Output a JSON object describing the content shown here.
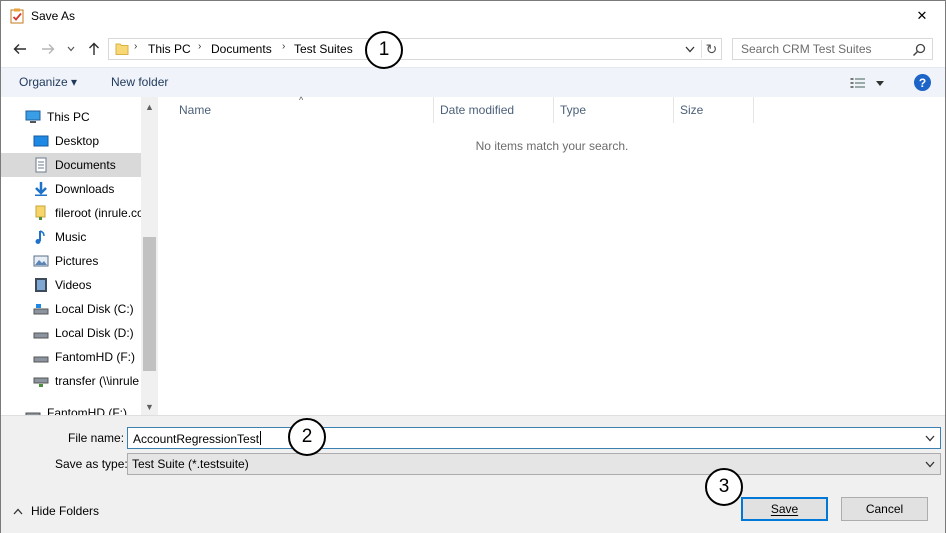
{
  "window": {
    "title": "Save As",
    "close_glyph": "✕"
  },
  "address": {
    "crumbs": [
      "This PC",
      "Documents",
      "Test Suites"
    ],
    "separator": "›",
    "refresh_glyph": "↻"
  },
  "search": {
    "placeholder": "Search CRM Test Suites"
  },
  "toolbar": {
    "organize": "Organize ▾",
    "new_folder": "New folder",
    "help": "?"
  },
  "nav": {
    "items": [
      {
        "label": "This PC",
        "icon": "computer-icon"
      },
      {
        "label": "Desktop",
        "icon": "desktop-icon"
      },
      {
        "label": "Documents",
        "icon": "documents-icon",
        "selected": true
      },
      {
        "label": "Downloads",
        "icon": "downloads-icon"
      },
      {
        "label": "fileroot (inrule.co",
        "icon": "network-folder-icon"
      },
      {
        "label": "Music",
        "icon": "music-icon"
      },
      {
        "label": "Pictures",
        "icon": "pictures-icon"
      },
      {
        "label": "Videos",
        "icon": "videos-icon"
      },
      {
        "label": "Local Disk (C:)",
        "icon": "drive-icon"
      },
      {
        "label": "Local Disk (D:)",
        "icon": "drive-icon"
      },
      {
        "label": "FantomHD (F:)",
        "icon": "drive-icon"
      },
      {
        "label": "transfer (\\\\inrule",
        "icon": "network-drive-icon"
      },
      {
        "label": "FantomHD (F:)",
        "icon": "drive-icon"
      }
    ]
  },
  "list": {
    "columns": [
      "Name",
      "Date modified",
      "Type",
      "Size"
    ],
    "sort_glyph": "^",
    "empty_message": "No items match your search."
  },
  "form": {
    "file_name_label": "File name:",
    "file_name_value": "AccountRegressionTest",
    "save_type_label": "Save as type:",
    "save_type_value": "Test Suite (*.testsuite)"
  },
  "footer": {
    "hide_folders": "Hide Folders",
    "save": "Save",
    "cancel": "Cancel"
  },
  "callouts": [
    "1",
    "2",
    "3"
  ],
  "colors": {
    "accent": "#0078d7",
    "help": "#1c64c8",
    "selection": "#d9d9d9"
  }
}
